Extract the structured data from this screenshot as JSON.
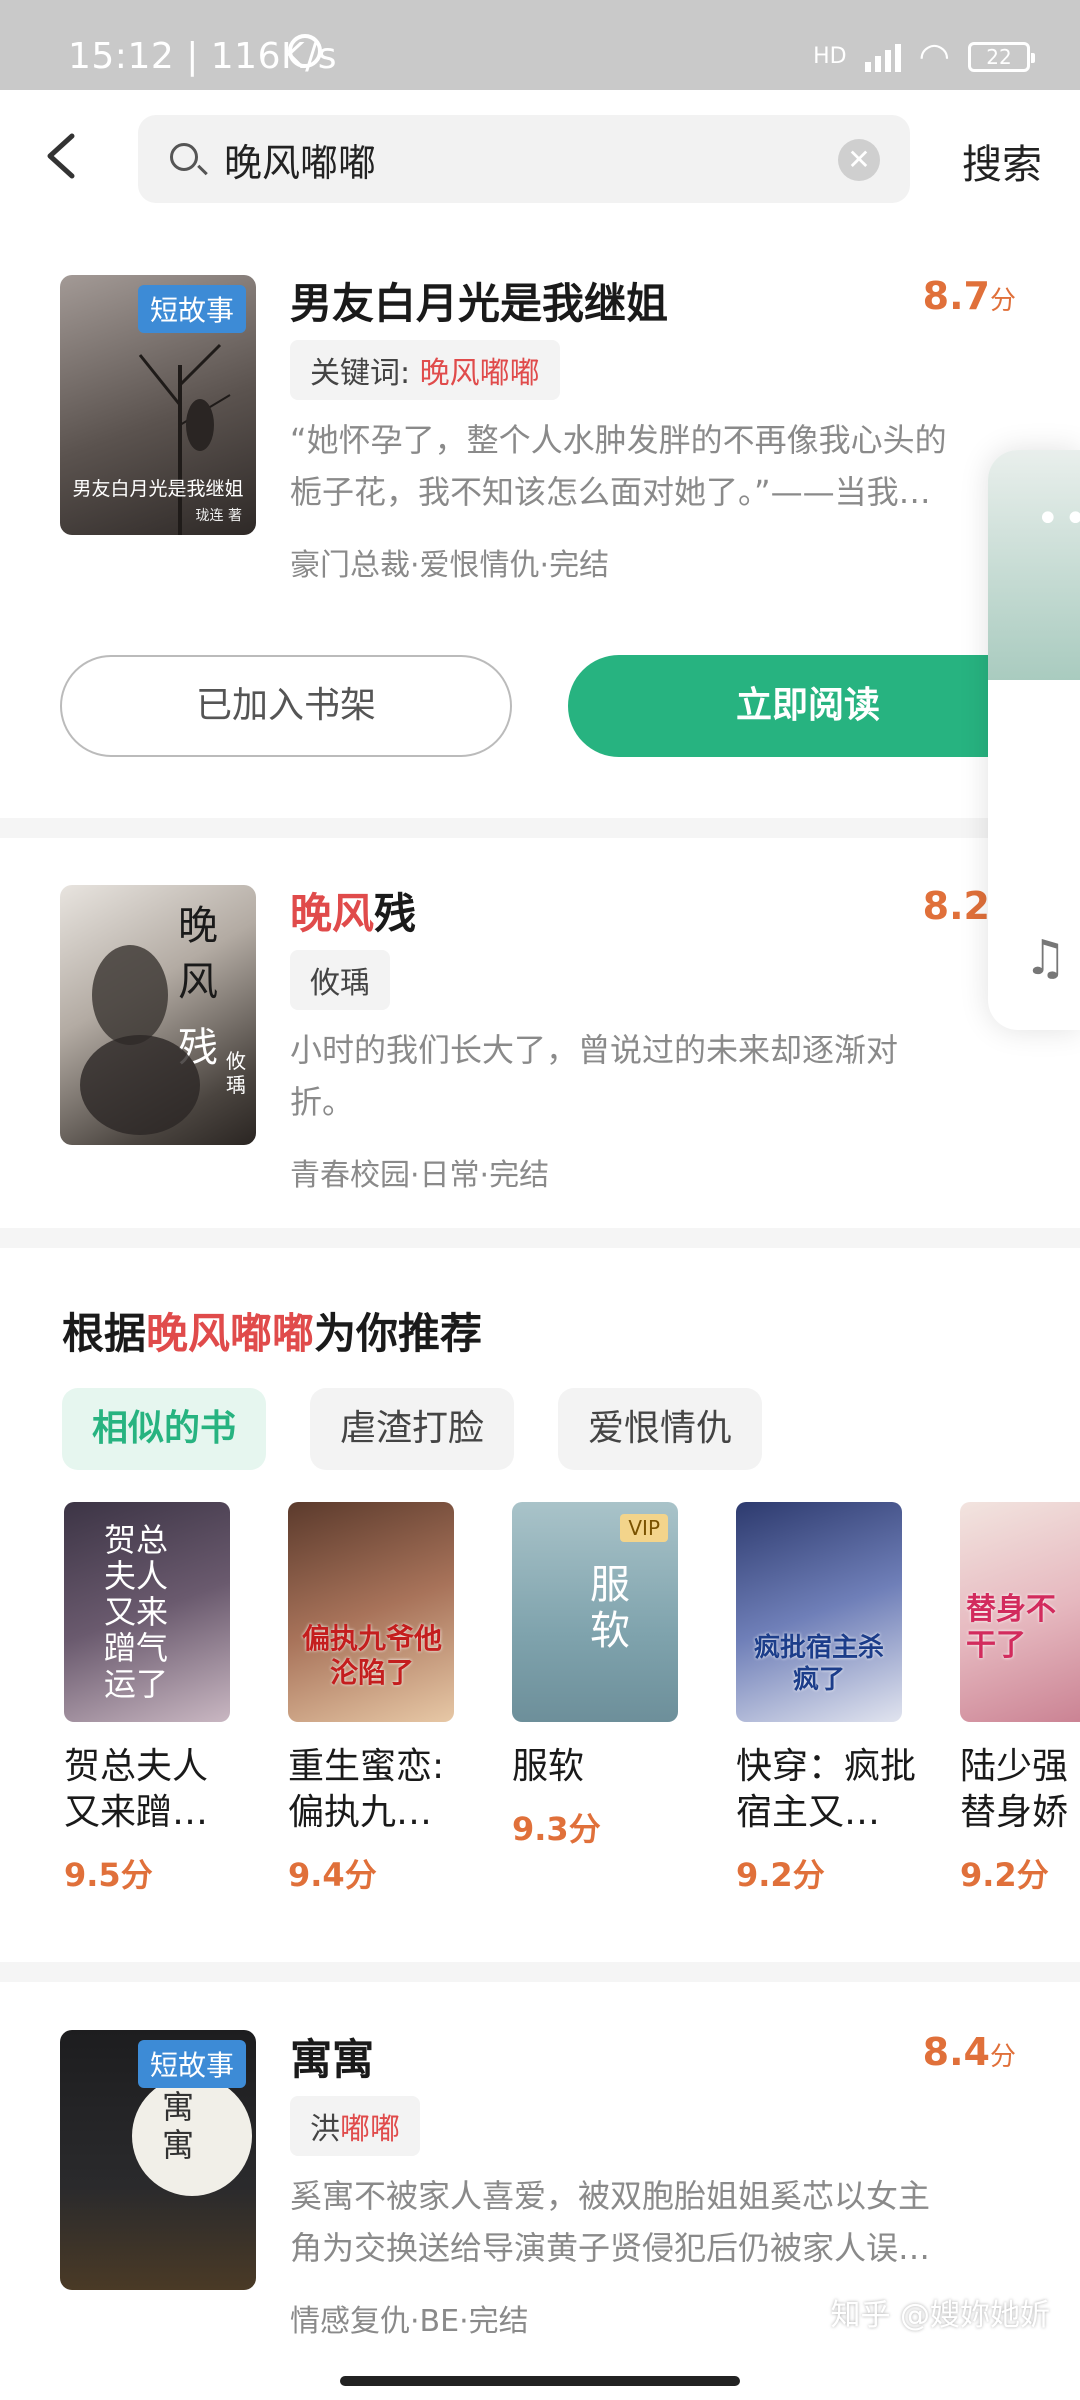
{
  "status_bar": {
    "time": "15:12",
    "speed": "116K/s",
    "network": "HD",
    "battery": "22"
  },
  "search": {
    "query": "晚风嘟嘟",
    "button_label": "搜索"
  },
  "results": [
    {
      "title": "男友白月光是我继姐",
      "badge": "短故事",
      "cover_text": "男友白月光是我继姐",
      "cover_author": "珑连 著",
      "rating": "8.7",
      "rating_unit": "分",
      "keyword_prefix": "关键词:",
      "keyword": "晚风嘟嘟",
      "desc": [
        "“她怀孕了，整个人水肿发胖的不再像我心头的",
        "栀子花，我不知该怎么面对她了。”——当我…"
      ],
      "meta": "豪门总裁·爱恨情仇·完结",
      "btn_shelf": "已加入书架",
      "btn_read": "立即阅读"
    },
    {
      "title_hl": "晚风",
      "title_rest": "残",
      "rating": "8.2",
      "author": "攸瑀",
      "cover_chars": [
        "晚",
        "风",
        "残"
      ],
      "cover_author": "攸瑀",
      "desc": [
        "小时的我们长大了，曾说过的未来却逐渐对",
        "折。"
      ],
      "meta": "青春校园·日常·完结"
    },
    {
      "title": "寓寓",
      "badge": "短故事",
      "cover_text": "寓寓",
      "rating": "8.4",
      "rating_unit": "分",
      "author_prefix": "洪",
      "author_hl": "嘟嘟",
      "desc": [
        "奚寓不被家人喜爱，被双胞胎姐姐奚芯以女主",
        "角为交换送给导演黄子贤侵犯后仍被家人误…"
      ],
      "meta": "情感复仇·BE·完结"
    }
  ],
  "recommend": {
    "prefix": "根据",
    "hl": "晚风嘟嘟",
    "suffix": "为你推荐",
    "chips": [
      "相似的书",
      "虐渣打脸",
      "爱恨情仇"
    ],
    "books": [
      {
        "title1": "贺总夫人",
        "title2": "又来蹭…",
        "score": "9.5分",
        "cover_text": "贺总夫人又来蹭气运了"
      },
      {
        "title1": "重生蜜恋:",
        "title2": "偏执九…",
        "score": "9.4分",
        "cover_text": "偏执九爷他沦陷了"
      },
      {
        "title1": "服软",
        "title2": "",
        "score": "9.3分",
        "cover_text": "服软",
        "vip": "VIP"
      },
      {
        "title1": "快穿：疯批",
        "title2": "宿主又…",
        "score": "9.2分",
        "cover_text": "疯批宿主杀疯了"
      },
      {
        "title1": "陆少强",
        "title2": "替身娇",
        "score": "9.2分",
        "cover_text": "替身不干了"
      }
    ]
  },
  "watermark": "知乎 @嫂妳她妡"
}
